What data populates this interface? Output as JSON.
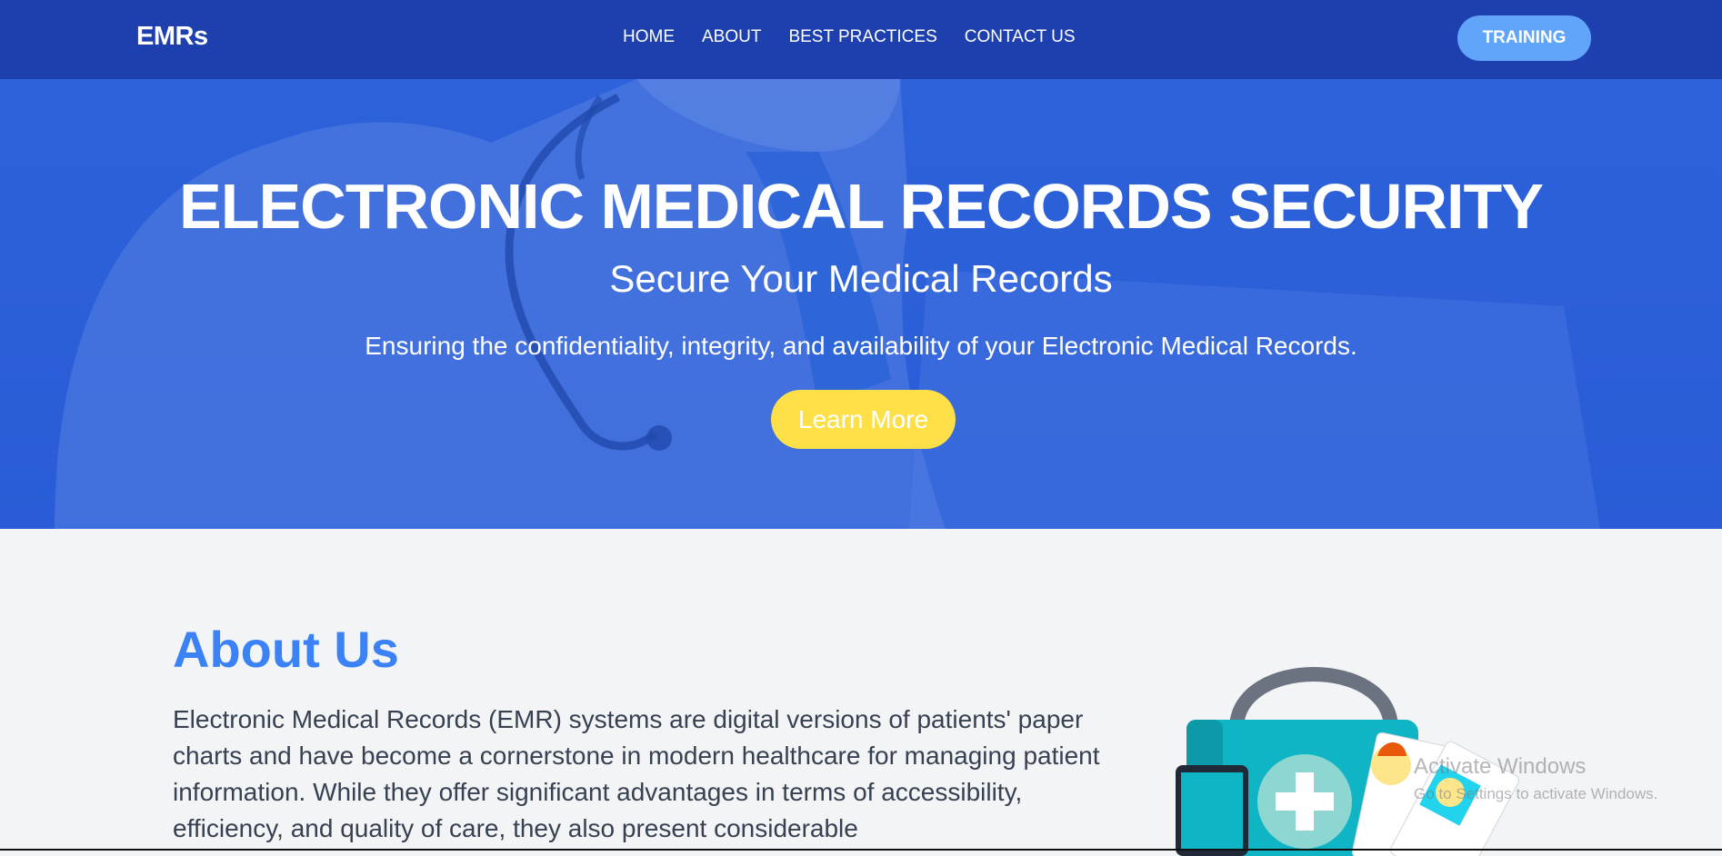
{
  "navbar": {
    "brand": "EMRs",
    "links": [
      "HOME",
      "ABOUT",
      "BEST PRACTICES",
      "CONTACT US"
    ],
    "cta_label": "TRAINING"
  },
  "hero": {
    "title": "ELECTRONIC MEDICAL RECORDS SECURITY",
    "subtitle": "Secure Your Medical Records",
    "description": "Ensuring the confidentiality, integrity, and availability of your Electronic Medical Records.",
    "button_label": "Learn More"
  },
  "about": {
    "title": "About Us",
    "paragraph": "Electronic Medical Records (EMR) systems are digital versions of patients' paper charts and have become a cornerstone in modern healthcare for managing patient information. While they offer significant advantages in terms of accessibility, efficiency, and quality of care, they also present considerable",
    "illustration_icon": "medical-records-lock-icon"
  },
  "watermark": {
    "title": "Activate Windows",
    "subtitle": "Go to Settings to activate Windows."
  },
  "colors": {
    "navbar_bg": "#1e40af",
    "training_btn": "#60a5fa",
    "learn_btn": "#fde047",
    "about_title": "#3b82f6",
    "page_bg": "#f3f4f6"
  }
}
